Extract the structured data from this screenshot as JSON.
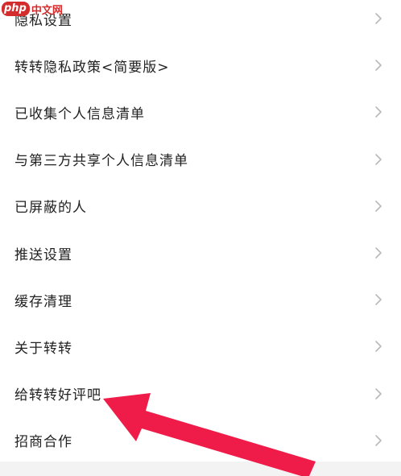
{
  "watermark": {
    "badge": "php",
    "text": "中文网"
  },
  "settings": {
    "items": [
      {
        "label": "隐私设置"
      },
      {
        "label": "转转隐私政策<简要版>"
      },
      {
        "label": "已收集个人信息清单"
      },
      {
        "label": "与第三方共享个人信息清单"
      },
      {
        "label": "已屏蔽的人"
      },
      {
        "label": "推送设置"
      },
      {
        "label": "缓存清理"
      },
      {
        "label": "关于转转"
      },
      {
        "label": "给转转好评吧"
      },
      {
        "label": "招商合作"
      }
    ]
  },
  "annotation": {
    "arrow_color": "#ef1c4a"
  },
  "icons": {
    "row_chevron": "chevron-right-icon"
  }
}
